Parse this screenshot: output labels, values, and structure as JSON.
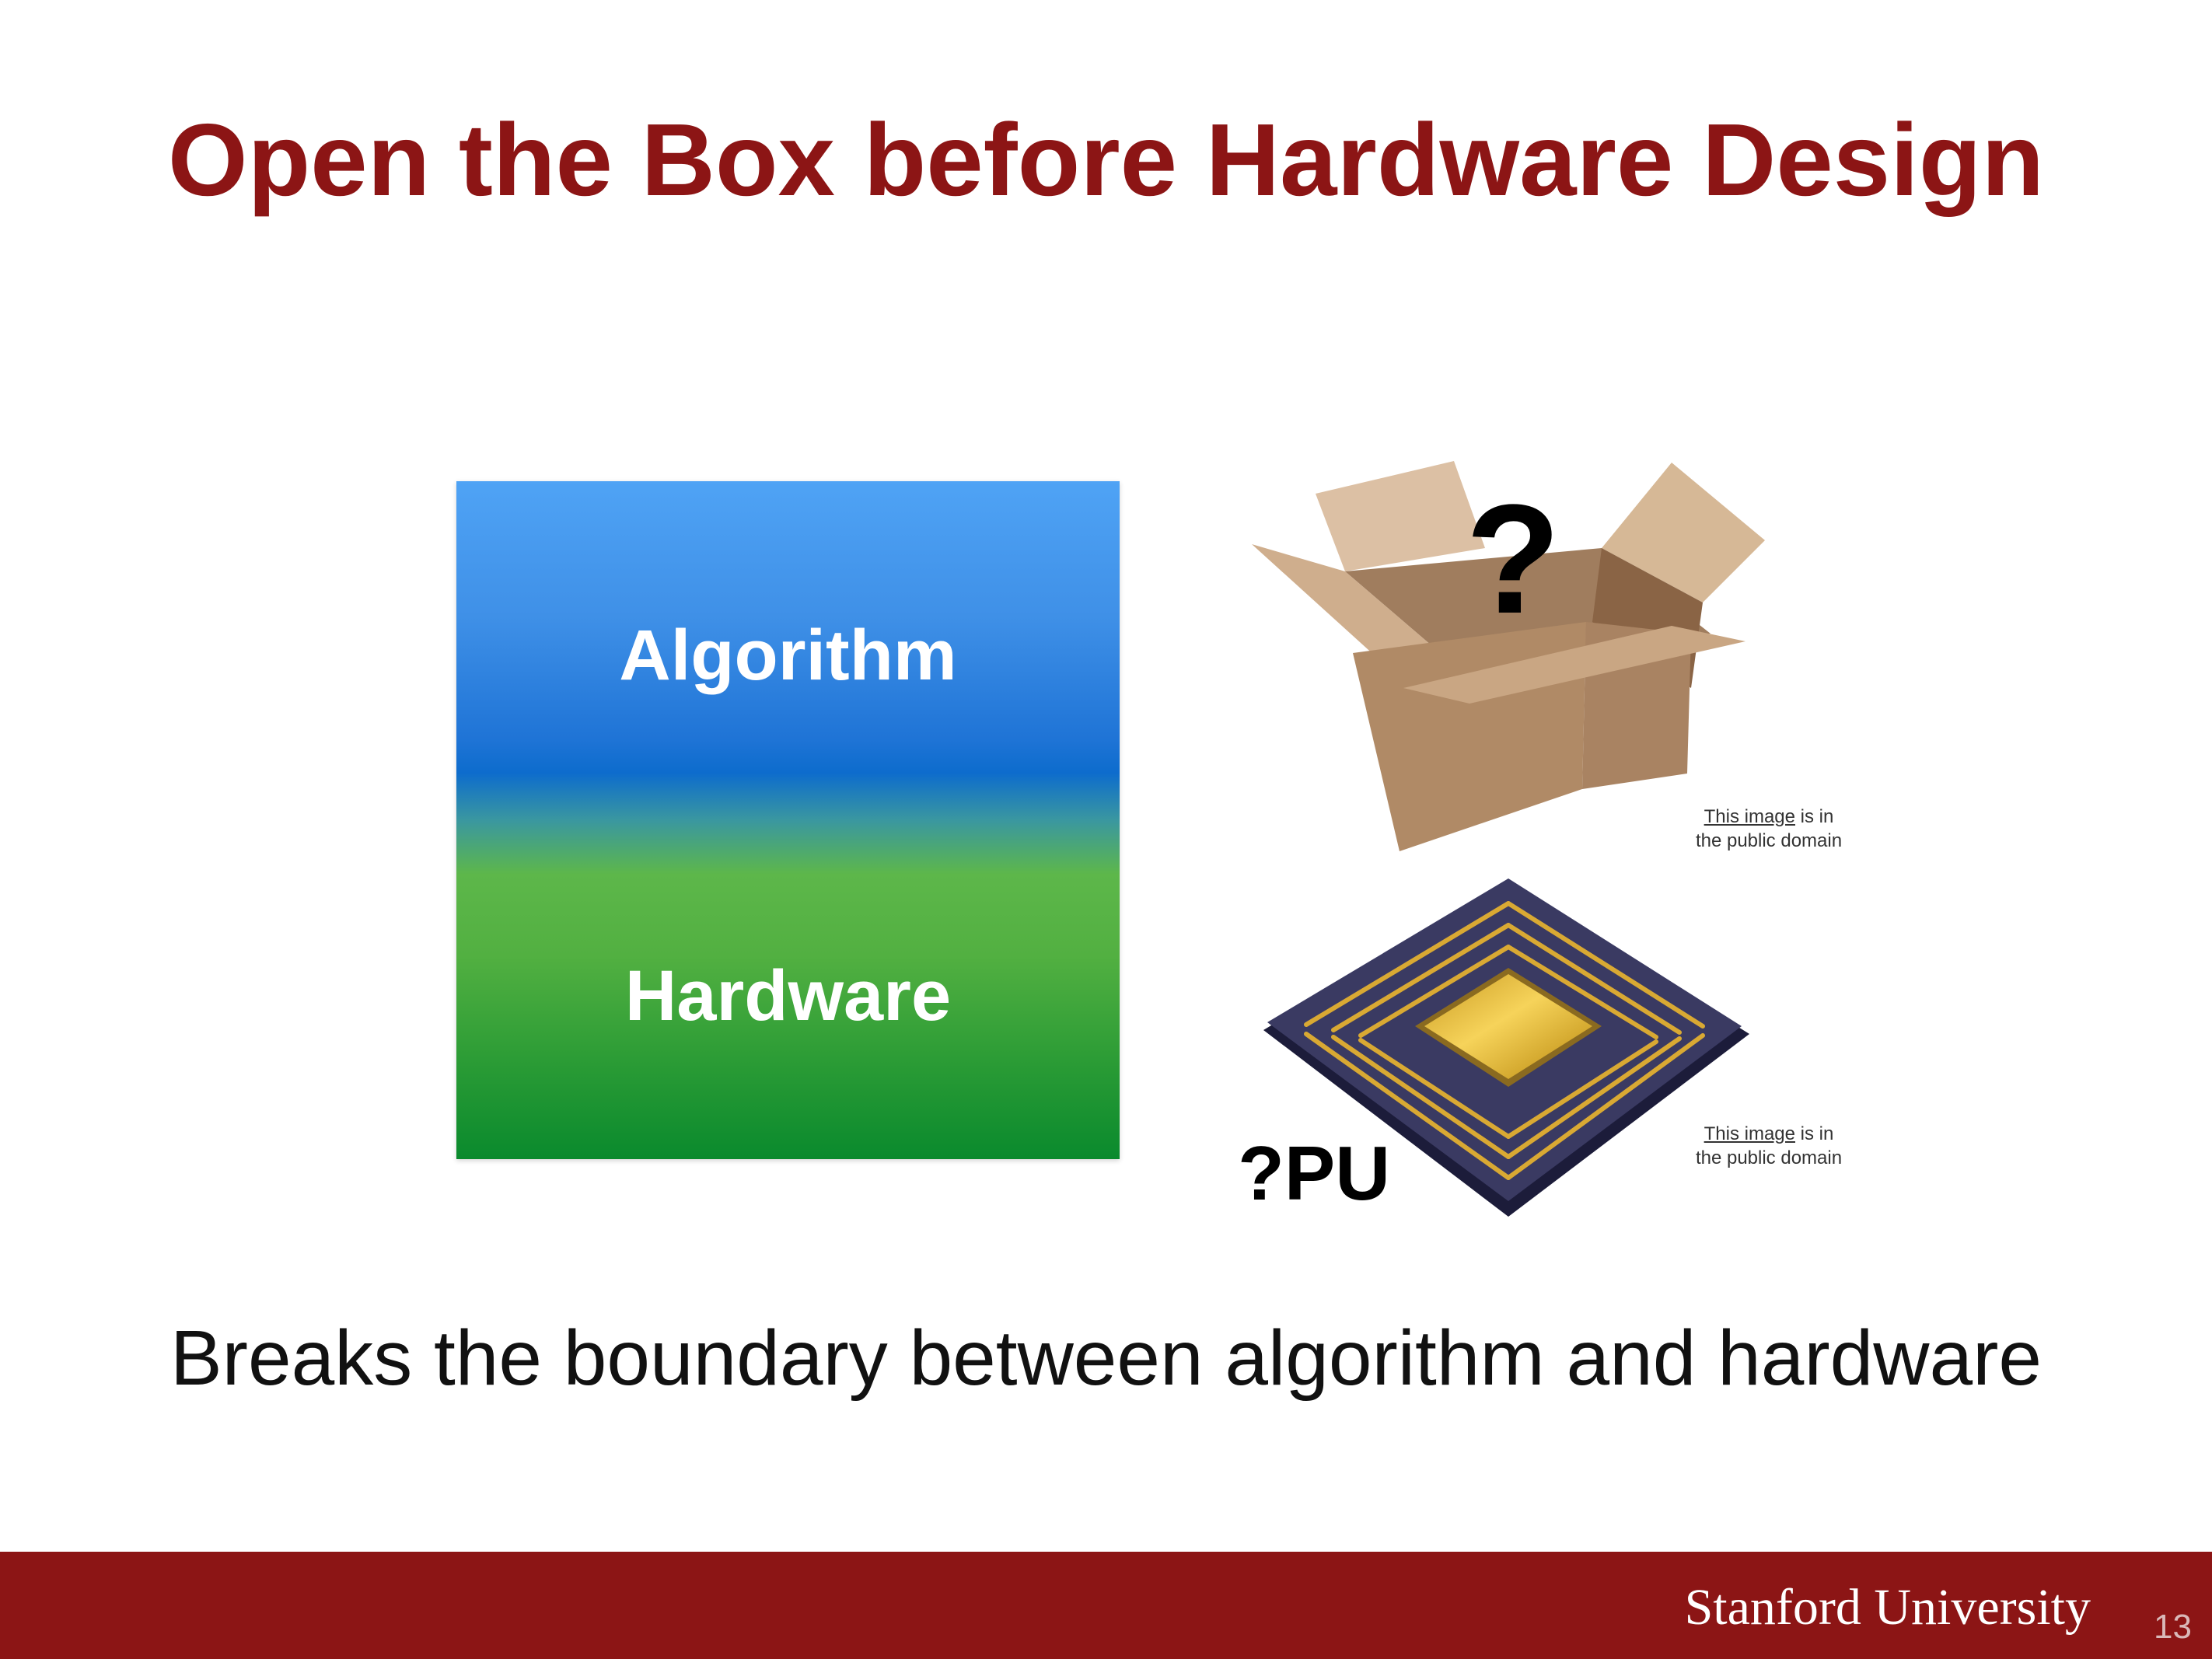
{
  "slide": {
    "title": "Open the Box before Hardware Design",
    "stack": {
      "top_label": "Algorithm",
      "bottom_label": "Hardware"
    },
    "box_image": {
      "overlay_text": "?",
      "credit_link": "This image",
      "credit_rest_line1": " is in",
      "credit_line2": "the public domain"
    },
    "chip_image": {
      "overlay_text": "?PU",
      "credit_link": "This image",
      "credit_rest_line1": " is in",
      "credit_line2": "the public domain"
    },
    "tagline": "Breaks the boundary between algorithm and hardware"
  },
  "footer": {
    "university": "Stanford University",
    "page_number": "13"
  },
  "colors": {
    "brand": "#8c1515",
    "algorithm_blue": "#1f74d6",
    "hardware_green": "#2a9b35"
  }
}
